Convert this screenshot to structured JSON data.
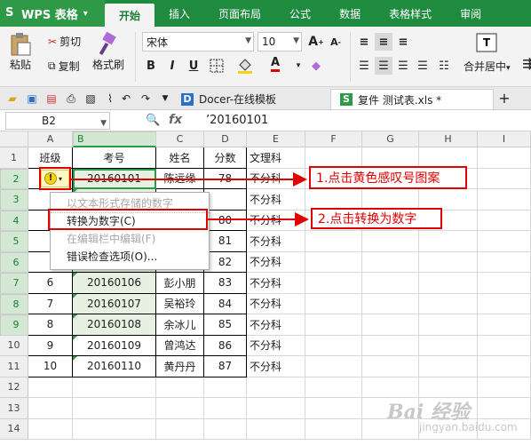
{
  "app": {
    "title": "WPS 表格"
  },
  "menu_tabs": [
    "开始",
    "插入",
    "页面布局",
    "公式",
    "数据",
    "表格样式",
    "审阅"
  ],
  "ribbon": {
    "paste": "粘贴",
    "cut": "剪切",
    "copy": "复制",
    "format_painter": "格式刷",
    "font_name": "宋体",
    "font_size": "10",
    "bold": "B",
    "italic": "I",
    "underline": "U",
    "font_color_letter": "A",
    "merge_center": "合并居中",
    "increase_font": "A",
    "decrease_font": "A"
  },
  "doc_tabs": [
    {
      "label": "Docer-在线模板"
    },
    {
      "label": "复件 测试表.xls *"
    }
  ],
  "formula_bar": {
    "name_box": "B2",
    "fx": "fx",
    "zoom_icon": "🔍",
    "value": "’20160101"
  },
  "columns": [
    "A",
    "B",
    "C",
    "D",
    "E",
    "F",
    "G",
    "H",
    "I"
  ],
  "rows": [
    "1",
    "2",
    "3",
    "4",
    "5",
    "6",
    "7",
    "8",
    "9",
    "10",
    "11",
    "12",
    "13",
    "14"
  ],
  "header_row": {
    "a": "班级",
    "b": "考号",
    "c": "姓名",
    "d": "分数",
    "e": "文理科"
  },
  "data_rows": [
    {
      "a": "",
      "b": "20160101",
      "c": "陈远缘",
      "d": "78",
      "e": "不分科"
    },
    {
      "a": "",
      "b": "",
      "c": "",
      "d": "",
      "e": "不分科"
    },
    {
      "a": "",
      "b": "",
      "c": "",
      "d": "80",
      "e": "不分科"
    },
    {
      "a": "",
      "b": "",
      "c": "",
      "d": "81",
      "e": "不分科"
    },
    {
      "a": "",
      "b": "",
      "c": "",
      "d": "82",
      "e": "不分科"
    },
    {
      "a": "6",
      "b": "20160106",
      "c": "彭小朋",
      "d": "83",
      "e": "不分科"
    },
    {
      "a": "7",
      "b": "20160107",
      "c": "吴裕玲",
      "d": "84",
      "e": "不分科"
    },
    {
      "a": "8",
      "b": "20160108",
      "c": "余冰儿",
      "d": "85",
      "e": "不分科"
    },
    {
      "a": "9",
      "b": "20160109",
      "c": "曾鸿达",
      "d": "86",
      "e": "不分科"
    },
    {
      "a": "10",
      "b": "20160110",
      "c": "黄丹丹",
      "d": "87",
      "e": "不分科"
    }
  ],
  "context_menu": [
    {
      "label": "以文本形式存储的数字",
      "disabled": true
    },
    {
      "label": "转换为数字(C)",
      "disabled": false
    },
    {
      "label": "在编辑栏中编辑(F)",
      "disabled": true
    },
    {
      "label": "错误检查选项(O)...",
      "disabled": false
    }
  ],
  "annotations": {
    "step1": "1.点击黄色感叹号图案",
    "step2": "2.点击转换为数字"
  },
  "colors": {
    "brand_green": "#1f8b3f",
    "annotation_red": "#e00000"
  },
  "watermark": {
    "brand": "Bai 经验",
    "site": "jingyan.baidu.com"
  }
}
